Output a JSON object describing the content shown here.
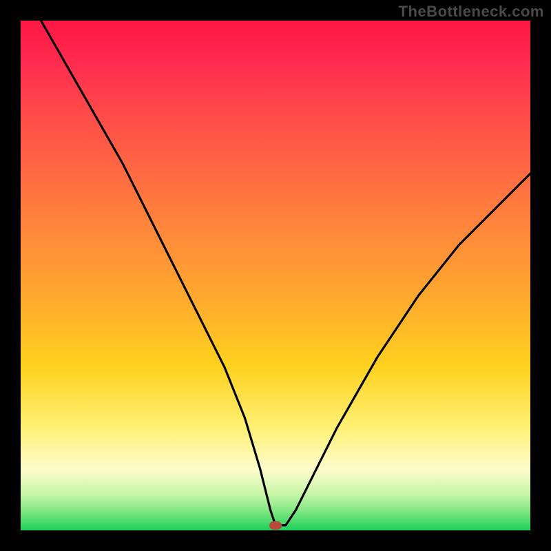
{
  "watermark": "TheBottleneck.com",
  "chart_data": {
    "type": "line",
    "title": "",
    "xlabel": "",
    "ylabel": "",
    "xlim": [
      0,
      100
    ],
    "ylim": [
      0,
      100
    ],
    "grid": false,
    "legend": false,
    "series": [
      {
        "name": "bottleneck-curve",
        "x": [
          4,
          8,
          12,
          16,
          20,
          24,
          28,
          32,
          36,
          40,
          44,
          47,
          49,
          50,
          52,
          54,
          58,
          62,
          66,
          70,
          74,
          78,
          82,
          86,
          90,
          94,
          98,
          100
        ],
        "y": [
          100,
          93,
          86,
          79,
          72,
          64,
          56,
          48,
          40,
          32,
          22,
          12,
          4,
          1,
          1,
          4,
          12,
          20,
          27,
          34,
          40,
          46,
          51,
          56,
          60,
          64,
          68,
          70
        ]
      }
    ],
    "marker": {
      "x": 50,
      "y": 1
    },
    "background_gradient": {
      "type": "vertical",
      "stops": [
        {
          "pos": 0,
          "color": "#ff1744"
        },
        {
          "pos": 18,
          "color": "#ff4a4a"
        },
        {
          "pos": 42,
          "color": "#ff8a3a"
        },
        {
          "pos": 68,
          "color": "#ffd21f"
        },
        {
          "pos": 88,
          "color": "#fdfccb"
        },
        {
          "pos": 100,
          "color": "#1dd05c"
        }
      ]
    }
  }
}
